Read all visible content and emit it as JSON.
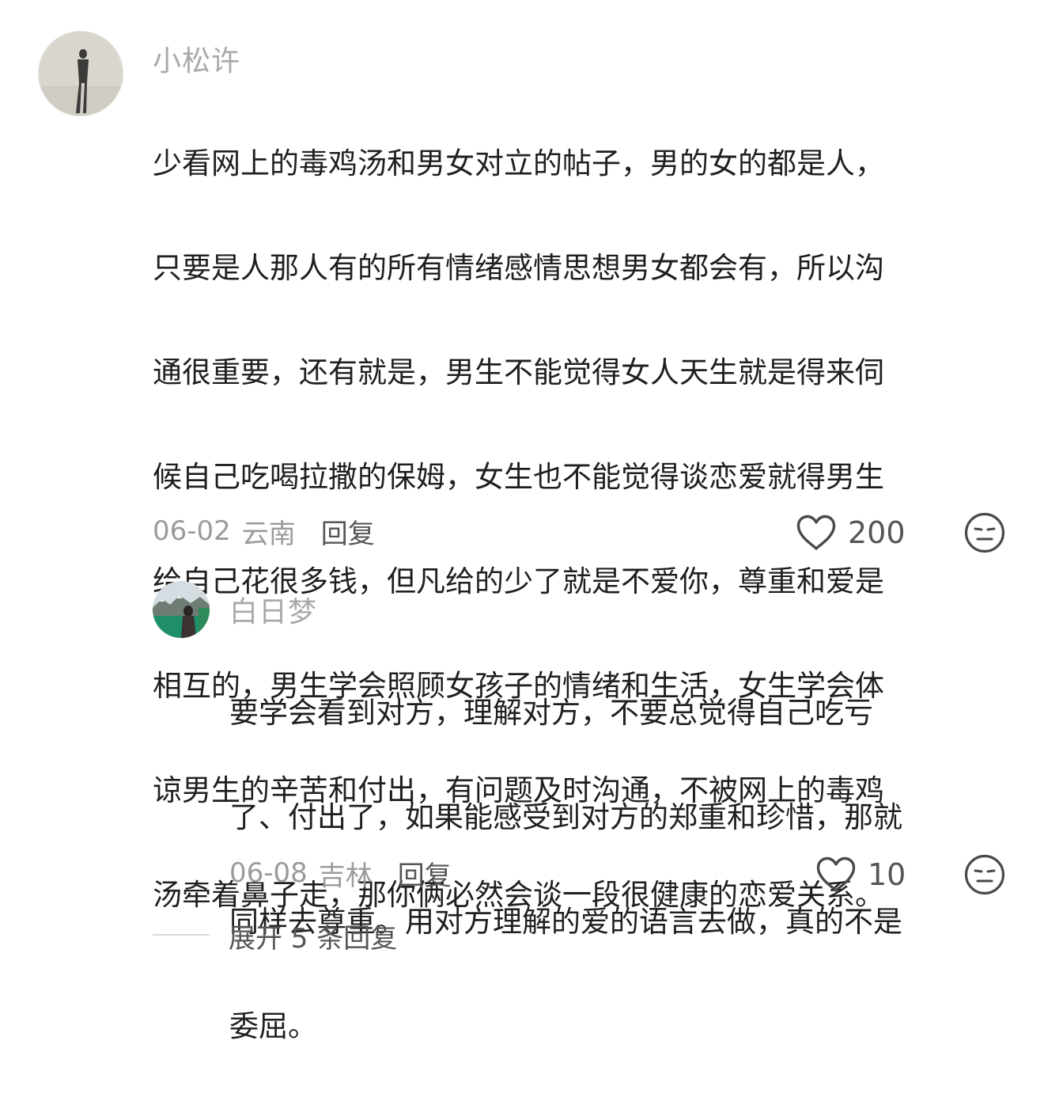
{
  "comment": {
    "username": "小松许",
    "avatar_icon": "person-photo-avatar",
    "lines": [
      "少看网上的毒鸡汤和男女对立的帖子，男的女的都是人，",
      "只要是人那人有的所有情绪感情思想男女都会有，所以沟",
      "通很重要，还有就是，男生不能觉得女人天生就是得来伺",
      "候自己吃喝拉撒的保姆，女生也不能觉得谈恋爱就得男生",
      "给自己花很多钱，但凡给的少了就是不爱你，尊重和爱是",
      "相互的，男生学会照顾女孩子的情绪和生活，女生学会体",
      "谅男生的辛苦和付出，有问题及时沟通，不被网上的毒鸡",
      "汤牵着鼻子走，那你俩必然会谈一段很健康的恋爱关系。"
    ],
    "date": "06-02",
    "location": "云南",
    "reply_label": "回复",
    "like_icon": "heart-outline-icon",
    "like_count": "200",
    "emoji_icon": "neutral-face-icon"
  },
  "reply": {
    "username": "白日梦",
    "avatar_icon": "landscape-photo-avatar",
    "lines": [
      "要学会看到对方，理解对方，不要总觉得自己吃亏",
      "了、付出了，如果能感受到对方的郑重和珍惜，那就",
      "同样去尊重。用对方理解的爱的语言去做，真的不是",
      "委屈。"
    ],
    "date": "06-08",
    "location": "吉林",
    "reply_label": "回复",
    "like_icon": "heart-outline-icon",
    "like_count": "10",
    "emoji_icon": "neutral-face-icon"
  },
  "expand": {
    "label": "展开 5 条回复"
  }
}
